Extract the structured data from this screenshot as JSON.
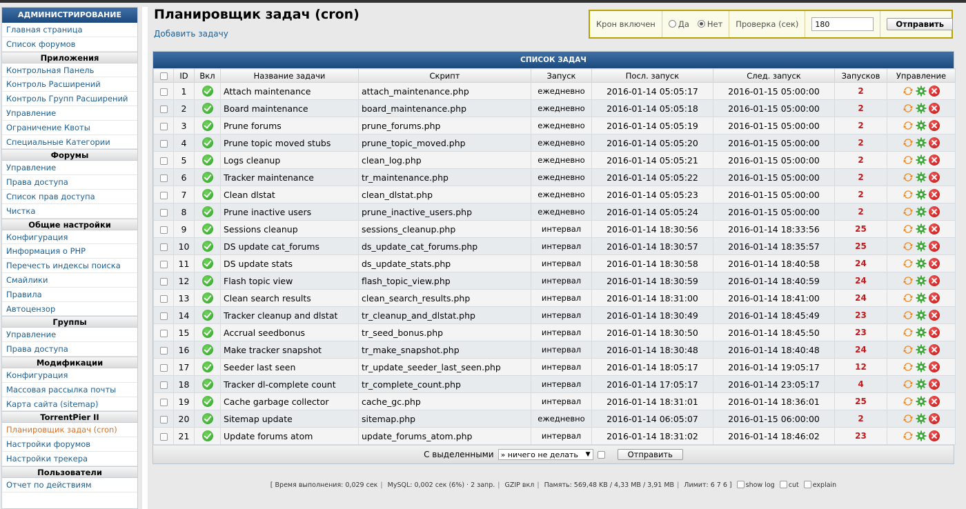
{
  "sidebar": {
    "header": "АДМИНИСТРИРОВАНИЕ",
    "blocks": [
      {
        "type": "item",
        "label": "Главная страница"
      },
      {
        "type": "item",
        "label": "Список форумов"
      },
      {
        "type": "section",
        "label": "Приложения"
      },
      {
        "type": "item",
        "label": "Контрольная Панель"
      },
      {
        "type": "item",
        "label": "Контроль Расширений"
      },
      {
        "type": "item",
        "label": "Контроль Групп Расширений"
      },
      {
        "type": "item",
        "label": "Управление"
      },
      {
        "type": "item",
        "label": "Ограничение Квоты"
      },
      {
        "type": "item",
        "label": "Специальные Категории"
      },
      {
        "type": "section",
        "label": "Форумы"
      },
      {
        "type": "item",
        "label": "Управление"
      },
      {
        "type": "item",
        "label": "Права доступа"
      },
      {
        "type": "item",
        "label": "Список прав доступа"
      },
      {
        "type": "item",
        "label": "Чистка"
      },
      {
        "type": "section",
        "label": "Общие настройки"
      },
      {
        "type": "item",
        "label": "Конфигурация"
      },
      {
        "type": "item",
        "label": "Информация о PHP"
      },
      {
        "type": "item",
        "label": "Перечесть индексы поиска"
      },
      {
        "type": "item",
        "label": "Смайлики"
      },
      {
        "type": "item",
        "label": "Правила"
      },
      {
        "type": "item",
        "label": "Автоцензор"
      },
      {
        "type": "section",
        "label": "Группы"
      },
      {
        "type": "item",
        "label": "Управление"
      },
      {
        "type": "item",
        "label": "Права доступа"
      },
      {
        "type": "section",
        "label": "Модификации"
      },
      {
        "type": "item",
        "label": "Конфигурация"
      },
      {
        "type": "item",
        "label": "Массовая рассылка почты"
      },
      {
        "type": "item",
        "label": "Карта сайта (sitemap)"
      },
      {
        "type": "section",
        "label": "TorrentPier II"
      },
      {
        "type": "item",
        "label": "Планировщик задач (cron)",
        "active": true
      },
      {
        "type": "item",
        "label": "Настройки форумов"
      },
      {
        "type": "item",
        "label": "Настройки трекера"
      },
      {
        "type": "section",
        "label": "Пользователи"
      },
      {
        "type": "item",
        "label": "Отчет по действиям"
      }
    ]
  },
  "header": {
    "title": "Планировщик задач (cron)",
    "add_task": "Добавить задачу"
  },
  "cron_control": {
    "enabled_label": "Крон включен",
    "yes_label": "Да",
    "no_label": "Нет",
    "selected": "Нет",
    "check_label": "Проверка (сек)",
    "check_value": "180",
    "submit_label": "Отправить"
  },
  "tasks": {
    "title": "СПИСОК ЗАДАЧ",
    "columns": [
      "",
      "ID",
      "Вкл",
      "Название задачи",
      "Скрипт",
      "Запуск",
      "Посл. запуск",
      "След. запуск",
      "Запусков",
      "Управление"
    ],
    "rows": [
      {
        "id": "1",
        "name": "Attach maintenance",
        "script": "attach_maintenance.php",
        "run": "ежедневно",
        "last": "2016-01-14 05:05:17",
        "next": "2016-01-15 05:00:00",
        "count": "2"
      },
      {
        "id": "2",
        "name": "Board maintenance",
        "script": "board_maintenance.php",
        "run": "ежедневно",
        "last": "2016-01-14 05:05:18",
        "next": "2016-01-15 05:00:00",
        "count": "2"
      },
      {
        "id": "3",
        "name": "Prune forums",
        "script": "prune_forums.php",
        "run": "ежедневно",
        "last": "2016-01-14 05:05:19",
        "next": "2016-01-15 05:00:00",
        "count": "2"
      },
      {
        "id": "4",
        "name": "Prune topic moved stubs",
        "script": "prune_topic_moved.php",
        "run": "ежедневно",
        "last": "2016-01-14 05:05:20",
        "next": "2016-01-15 05:00:00",
        "count": "2"
      },
      {
        "id": "5",
        "name": "Logs cleanup",
        "script": "clean_log.php",
        "run": "ежедневно",
        "last": "2016-01-14 05:05:21",
        "next": "2016-01-15 05:00:00",
        "count": "2"
      },
      {
        "id": "6",
        "name": "Tracker maintenance",
        "script": "tr_maintenance.php",
        "run": "ежедневно",
        "last": "2016-01-14 05:05:22",
        "next": "2016-01-15 05:00:00",
        "count": "2"
      },
      {
        "id": "7",
        "name": "Clean dlstat",
        "script": "clean_dlstat.php",
        "run": "ежедневно",
        "last": "2016-01-14 05:05:23",
        "next": "2016-01-15 05:00:00",
        "count": "2"
      },
      {
        "id": "8",
        "name": "Prune inactive users",
        "script": "prune_inactive_users.php",
        "run": "ежедневно",
        "last": "2016-01-14 05:05:24",
        "next": "2016-01-15 05:00:00",
        "count": "2"
      },
      {
        "id": "9",
        "name": "Sessions cleanup",
        "script": "sessions_cleanup.php",
        "run": "интервал",
        "last": "2016-01-14 18:30:56",
        "next": "2016-01-14 18:33:56",
        "count": "25"
      },
      {
        "id": "10",
        "name": "DS update cat_forums",
        "script": "ds_update_cat_forums.php",
        "run": "интервал",
        "last": "2016-01-14 18:30:57",
        "next": "2016-01-14 18:35:57",
        "count": "25"
      },
      {
        "id": "11",
        "name": "DS update stats",
        "script": "ds_update_stats.php",
        "run": "интервал",
        "last": "2016-01-14 18:30:58",
        "next": "2016-01-14 18:40:58",
        "count": "24"
      },
      {
        "id": "12",
        "name": "Flash topic view",
        "script": "flash_topic_view.php",
        "run": "интервал",
        "last": "2016-01-14 18:30:59",
        "next": "2016-01-14 18:40:59",
        "count": "24"
      },
      {
        "id": "13",
        "name": "Clean search results",
        "script": "clean_search_results.php",
        "run": "интервал",
        "last": "2016-01-14 18:31:00",
        "next": "2016-01-14 18:41:00",
        "count": "24"
      },
      {
        "id": "14",
        "name": "Tracker cleanup and dlstat",
        "script": "tr_cleanup_and_dlstat.php",
        "run": "интервал",
        "last": "2016-01-14 18:30:49",
        "next": "2016-01-14 18:45:49",
        "count": "23"
      },
      {
        "id": "15",
        "name": "Accrual seedbonus",
        "script": "tr_seed_bonus.php",
        "run": "интервал",
        "last": "2016-01-14 18:30:50",
        "next": "2016-01-14 18:45:50",
        "count": "23"
      },
      {
        "id": "16",
        "name": "Make tracker snapshot",
        "script": "tr_make_snapshot.php",
        "run": "интервал",
        "last": "2016-01-14 18:30:48",
        "next": "2016-01-14 18:40:48",
        "count": "24"
      },
      {
        "id": "17",
        "name": "Seeder last seen",
        "script": "tr_update_seeder_last_seen.php",
        "run": "интервал",
        "last": "2016-01-14 18:05:17",
        "next": "2016-01-14 19:05:17",
        "count": "12"
      },
      {
        "id": "18",
        "name": "Tracker dl-complete count",
        "script": "tr_complete_count.php",
        "run": "интервал",
        "last": "2016-01-14 17:05:17",
        "next": "2016-01-14 23:05:17",
        "count": "4"
      },
      {
        "id": "19",
        "name": "Cache garbage collector",
        "script": "cache_gc.php",
        "run": "интервал",
        "last": "2016-01-14 18:31:01",
        "next": "2016-01-14 18:36:01",
        "count": "25"
      },
      {
        "id": "20",
        "name": "Sitemap update",
        "script": "sitemap.php",
        "run": "ежедневно",
        "last": "2016-01-14 06:05:07",
        "next": "2016-01-15 06:00:00",
        "count": "2"
      },
      {
        "id": "21",
        "name": "Update forums atom",
        "script": "update_forums_atom.php",
        "run": "интервал",
        "last": "2016-01-14 18:31:02",
        "next": "2016-01-14 18:46:02",
        "count": "23"
      }
    ],
    "footer": {
      "with_selected": "С выделенными",
      "action_value": "» ничего не делать",
      "submit_label": "Отправить"
    }
  },
  "stats": {
    "time": "[ Время выполнения: 0,029 сек",
    "mysql": "MySQL: 0,002 сек (6%) · 2 запр.",
    "gzip": "GZIP вкл",
    "memory": "Память: 569,48 KB / 4,33 MB / 3,91 MB",
    "limit": "Лимит: 6 7 6 ]",
    "show_log": "show log",
    "cut": "cut",
    "explain": "explain"
  },
  "colors": {
    "header_blue": "#1d4a7d",
    "link": "#1d5e92",
    "active_link": "#d8702a",
    "count_red": "#c1191b",
    "cron_border": "#b9a200"
  }
}
